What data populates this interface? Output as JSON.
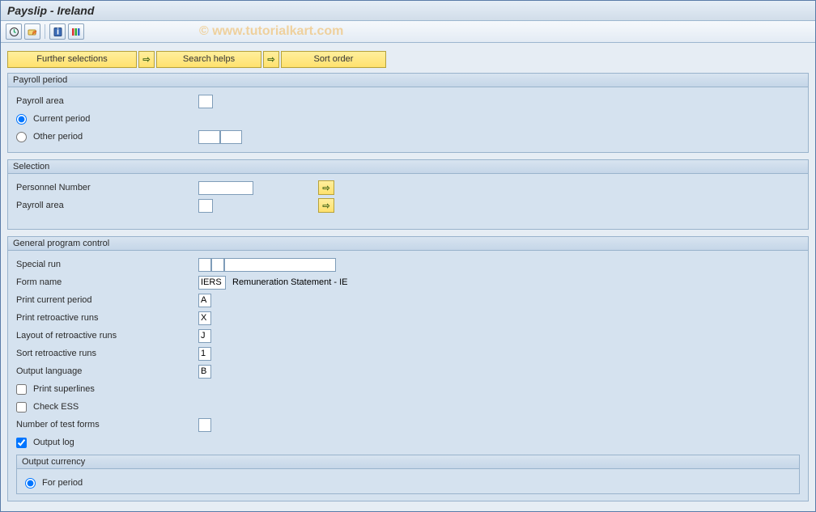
{
  "title": "Payslip - Ireland",
  "watermark": "© www.tutorialkart.com",
  "toolbar": {
    "icons": [
      "execute-icon",
      "variant-icon",
      "info-icon",
      "list-icon"
    ]
  },
  "button_row": {
    "further_selections": "Further selections",
    "search_helps": "Search helps",
    "sort_order": "Sort order"
  },
  "groups": {
    "payroll_period": {
      "title": "Payroll period",
      "payroll_area_label": "Payroll area",
      "payroll_area_value": "",
      "current_period_label": "Current period",
      "other_period_label": "Other period",
      "other_period_v1": "",
      "other_period_v2": ""
    },
    "selection": {
      "title": "Selection",
      "personnel_number_label": "Personnel Number",
      "personnel_number_value": "",
      "payroll_area_label": "Payroll area",
      "payroll_area_value": ""
    },
    "general": {
      "title": "General program control",
      "special_run_label": "Special run",
      "special_run_v1": "",
      "special_run_v2": "",
      "special_run_v3": "",
      "form_name_label": "Form name",
      "form_name_value": "IERS",
      "form_name_desc": "Remuneration Statement - IE",
      "print_current_period_label": "Print current period",
      "print_current_period_value": "A",
      "print_retro_runs_label": "Print retroactive runs",
      "print_retro_runs_value": "X",
      "layout_retro_runs_label": "Layout of retroactive runs",
      "layout_retro_runs_value": "J",
      "sort_retro_runs_label": "Sort retroactive runs",
      "sort_retro_runs_value": "1",
      "output_language_label": "Output language",
      "output_language_value": "B",
      "print_superlines_label": "Print superlines",
      "check_ess_label": "Check ESS",
      "number_test_forms_label": "Number of test forms",
      "number_test_forms_value": "",
      "output_log_label": "Output log",
      "output_currency_title": "Output currency",
      "for_period_label": "For period"
    }
  }
}
